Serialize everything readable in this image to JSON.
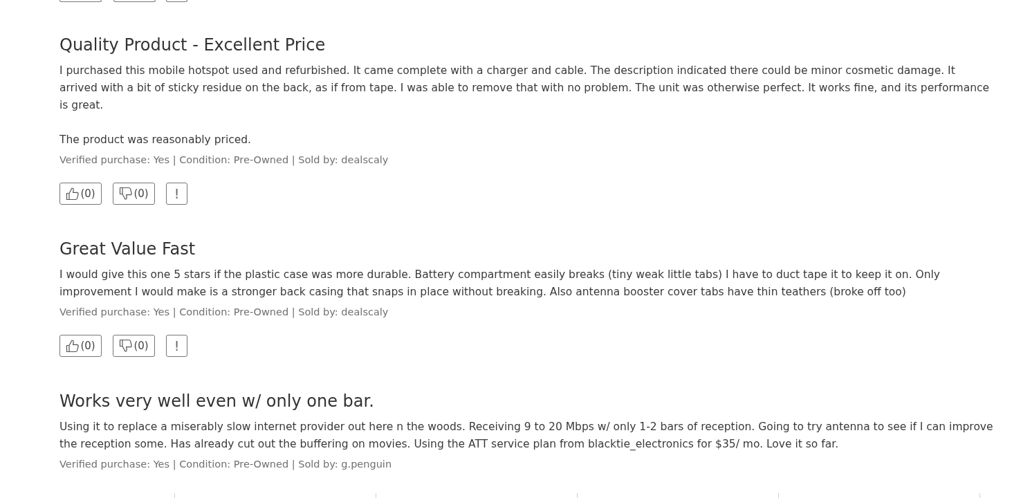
{
  "reviews": [
    {
      "title": "Quality Product - Excellent Price",
      "paragraphs": [
        "I purchased this mobile hotspot used and refurbished. It came complete with a charger and cable. The description indicated there could be minor cosmetic damage. It arrived with a bit of sticky residue on the back, as if from tape. I was able to remove that with no problem. The unit was otherwise perfect. It works fine, and its performance is great.",
        "The product was reasonably priced."
      ],
      "meta": "Verified purchase: Yes | Condition: Pre-Owned | Sold by: dealscaly",
      "buttons": [
        {
          "kind": "helpful",
          "label": "(0)"
        },
        {
          "kind": "unhelpful",
          "label": "(0)"
        },
        {
          "kind": "report",
          "label": "!"
        }
      ]
    },
    {
      "title": "Great Value Fast",
      "paragraphs": [
        "I would give this one 5 stars if the plastic case was more durable. Battery compartment easily breaks (tiny weak little tabs) I have to duct tape it to keep it on.  Only improvement I would make is a stronger back casing that snaps in place without breaking.  Also antenna booster cover tabs have thin teathers (broke off too)"
      ],
      "meta": "Verified purchase: Yes | Condition: Pre-Owned | Sold by: dealscaly",
      "buttons": [
        {
          "kind": "helpful",
          "label": "(0)"
        },
        {
          "kind": "unhelpful",
          "label": "(0)"
        },
        {
          "kind": "report",
          "label": "!"
        }
      ]
    },
    {
      "title": "Works very well even w/ only one bar.",
      "paragraphs": [
        "Using it to replace a miserably slow internet provider out here n the woods. Receiving 9 to 20 Mbps w/ only 1-2 bars of reception. Going to try antenna to see if I can improve the reception some. Has already cut out the buffering on movies. Using the ATT service plan from blacktie_electronics for $35/ mo. Love it so far."
      ],
      "meta": "Verified purchase: Yes | Condition: Pre-Owned | Sold by: g.penguin"
    }
  ]
}
